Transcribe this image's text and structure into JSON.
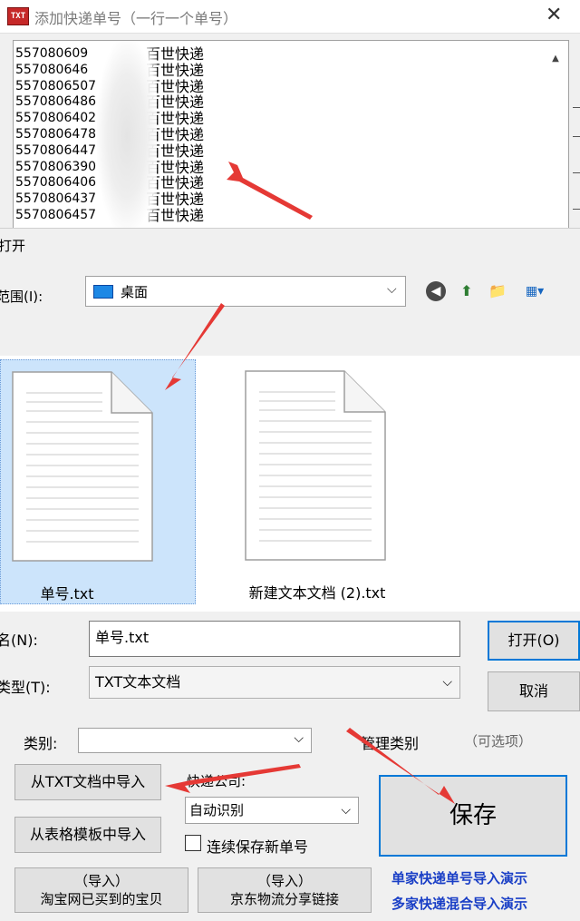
{
  "back_window": {
    "title": "添加快递单号（一行一个单号）",
    "app_icon_text": "TXT",
    "close_icon": "close-icon",
    "tracking_rows": [
      {
        "number": "557080609",
        "carrier": "百世快递"
      },
      {
        "number": "557080646",
        "carrier": "百世快递"
      },
      {
        "number": "5570806507",
        "carrier": "百世快递"
      },
      {
        "number": "5570806486",
        "carrier": "百世快递"
      },
      {
        "number": "5570806402",
        "carrier": "百世快递"
      },
      {
        "number": "5570806478",
        "carrier": "百世快递"
      },
      {
        "number": "5570806447",
        "carrier": "百世快递"
      },
      {
        "number": "5570806390",
        "carrier": "百世快递"
      },
      {
        "number": "5570806406",
        "carrier": "百世快递"
      },
      {
        "number": "5570806437",
        "carrier": "百世快递"
      },
      {
        "number": "5570806457",
        "carrier": "百世快递"
      }
    ],
    "category_label": "类别:",
    "manage_category": "管理类别",
    "optional_hint": "（可选项）",
    "import_txt": "从TXT文档中导入",
    "import_template": "从表格模板中导入",
    "import_taobao_line1": "（导入）",
    "import_taobao_line2": "淘宝网已买到的宝贝",
    "import_jd_line1": "（导入）",
    "import_jd_line2": "京东物流分享链接",
    "carrier_label": "快递公司:",
    "carrier_value": "自动识别",
    "continuous_save": "连续保存新单号",
    "save": "保存",
    "demo_single": "单家快递单号导入演示",
    "demo_multi": "多家快递混合导入演示"
  },
  "open_dialog": {
    "title": "打开",
    "lookin_label": "范围(I):",
    "lookin_value": "桌面",
    "files": [
      {
        "name": "单号.txt",
        "selected": true
      },
      {
        "name": "新建文本文档 (2).txt",
        "selected": false
      }
    ],
    "filename_label": "名(N):",
    "filename_value": "单号.txt",
    "filetype_label": "类型(T):",
    "filetype_value": "TXT文本文档",
    "open_button": "打开(O)",
    "cancel_button": "取消"
  },
  "colors": {
    "accent_blue": "#0078d7",
    "selection": "#cce4fb",
    "arrow_red": "#e53935",
    "demo_link": "#1a3fc6"
  }
}
